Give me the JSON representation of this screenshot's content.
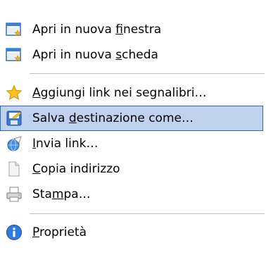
{
  "menu": {
    "items": [
      {
        "pre": "Apri in nuova ",
        "key": "f",
        "post": "inestra",
        "icon": "new-window-icon"
      },
      {
        "pre": "Apri in nuova ",
        "key": "s",
        "post": "cheda",
        "icon": "new-tab-icon"
      },
      {
        "pre": "",
        "key": "A",
        "post": "ggiungi link nei segnalibri…",
        "icon": "star-icon"
      },
      {
        "pre": "Salva ",
        "key": "d",
        "post": "estinazione come…",
        "icon": "save-target-icon"
      },
      {
        "pre": "",
        "key": "I",
        "post": "nvia link…",
        "icon": "send-link-icon"
      },
      {
        "pre": "",
        "key": "C",
        "post": "opia indirizzo",
        "icon": "copy-icon"
      },
      {
        "pre": "Sta",
        "key": "m",
        "post": "pa…",
        "icon": "printer-icon"
      },
      {
        "pre": "",
        "key": "P",
        "post": "roprietà",
        "icon": "info-icon"
      }
    ],
    "highlighted_index": 3,
    "colors": {
      "highlight_bg": "#c1d2ee",
      "highlight_border": "#316ac5",
      "separator": "#c5c2b8",
      "text": "#000000"
    }
  }
}
